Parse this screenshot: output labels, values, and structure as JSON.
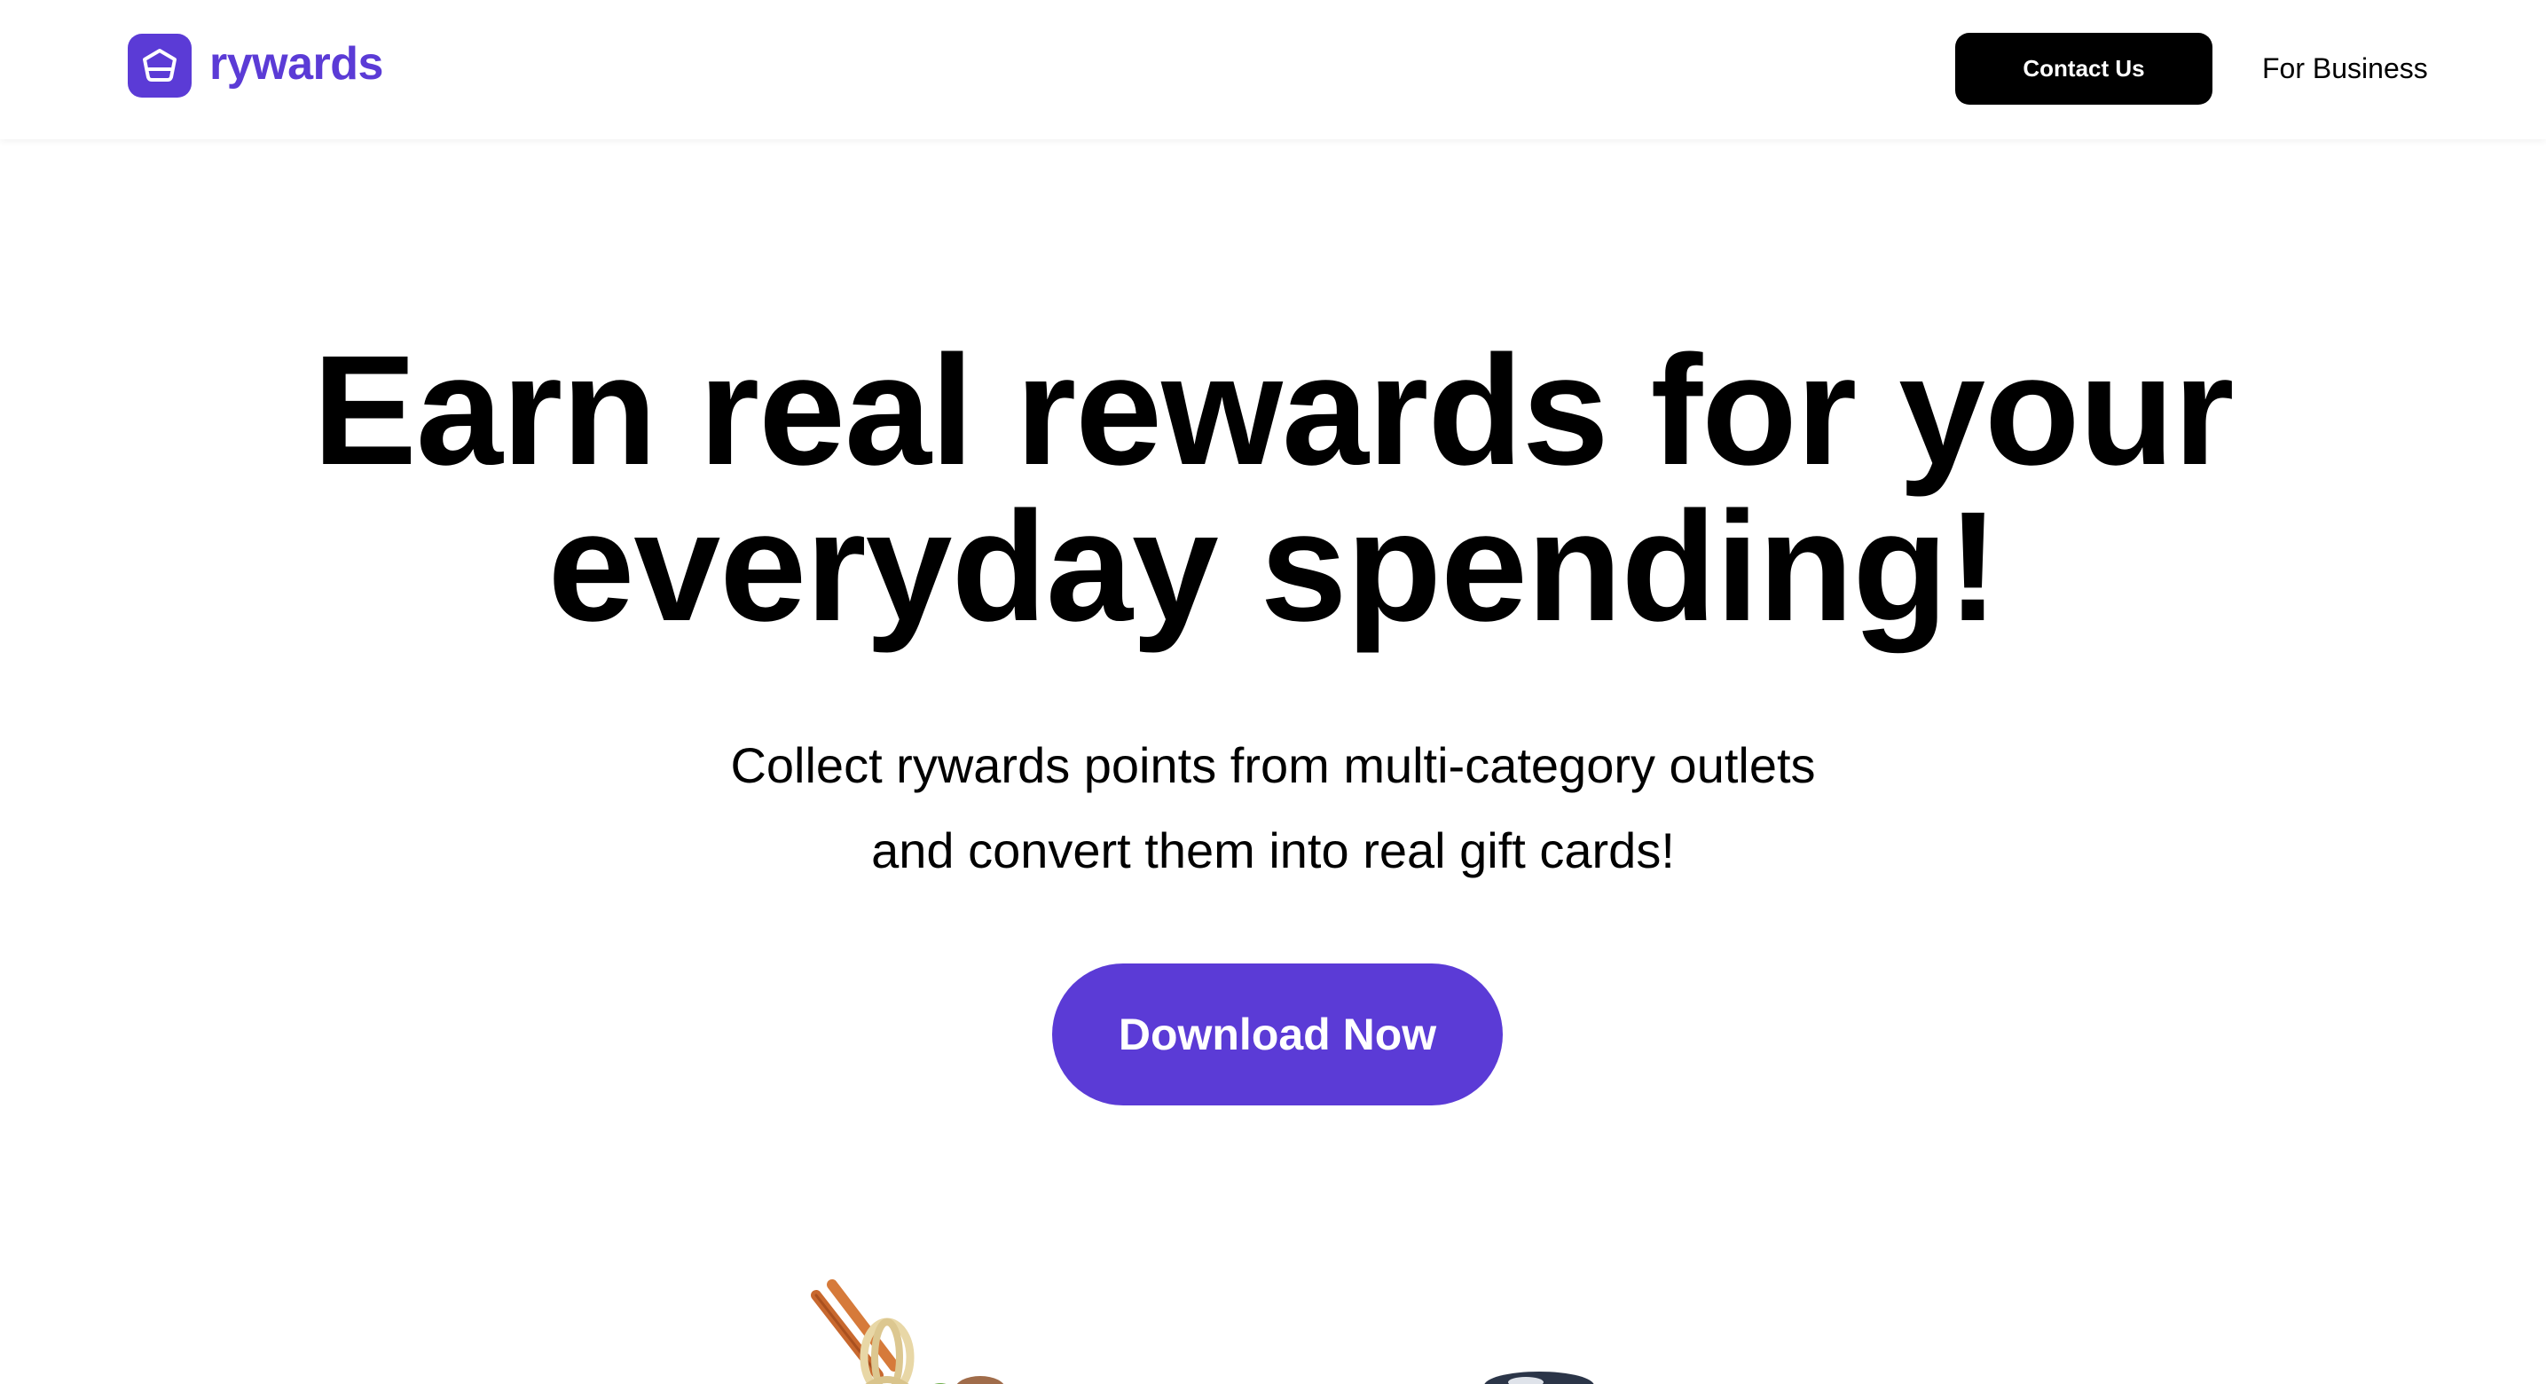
{
  "brand": {
    "name": "rywards",
    "accent_color": "#5b3bd6",
    "logo_icon": "pentagon-house-icon"
  },
  "nav": {
    "contact_label": "Contact Us",
    "business_label": "For Business"
  },
  "hero": {
    "title": "Earn real rewards for your everyday spending!",
    "subtitle_line1": "Collect rywards points from multi-category outlets",
    "subtitle_line2": "and convert them into real gift cards!",
    "cta_label": "Download Now",
    "cta_color": "#5b3bd6"
  },
  "images": [
    {
      "icon": "noodles-chopsticks-image"
    },
    {
      "icon": "sneaker-image"
    }
  ]
}
